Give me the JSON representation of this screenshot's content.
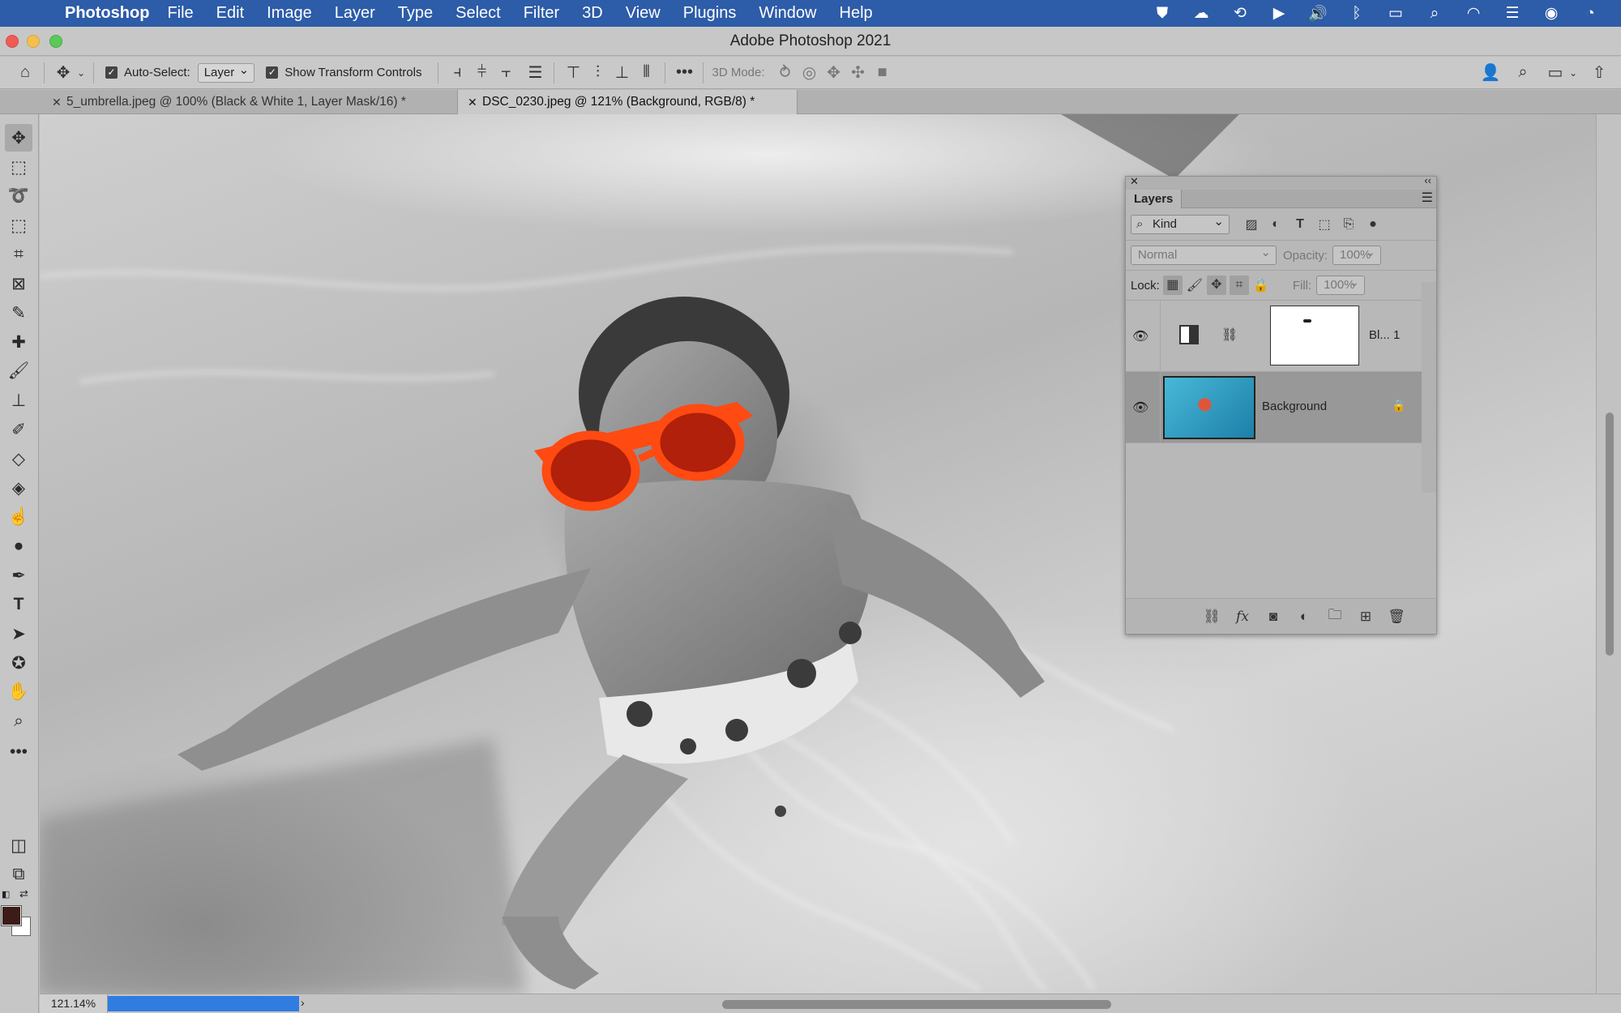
{
  "menubar": {
    "app_name": "Photoshop",
    "items": [
      "File",
      "Edit",
      "Image",
      "Layer",
      "Type",
      "Select",
      "Filter",
      "3D",
      "View",
      "Plugins",
      "Window",
      "Help"
    ]
  },
  "window": {
    "title": "Adobe Photoshop 2021"
  },
  "options": {
    "auto_select_label": "Auto-Select:",
    "auto_select_value": "Layer",
    "show_transform_label": "Show Transform Controls",
    "mode_3d_label": "3D Mode:"
  },
  "tabs": [
    {
      "label": "5_umbrella.jpeg @ 100% (Black & White 1, Layer Mask/16) *",
      "active": false
    },
    {
      "label": "DSC_0230.jpeg @ 121% (Background, RGB/8) *",
      "active": true
    }
  ],
  "status": {
    "zoom": "121.14%"
  },
  "layers_panel": {
    "title": "Layers",
    "filter_kind": "Kind",
    "blend_mode": "Normal",
    "opacity_label": "Opacity:",
    "opacity_value": "100%",
    "lock_label": "Lock:",
    "fill_label": "Fill:",
    "fill_value": "100%",
    "layers": [
      {
        "name": "Bl... 1"
      },
      {
        "name": "Background"
      }
    ]
  },
  "colors": {
    "accent": "#2d5ca8",
    "sunglasses": "#ff4a12",
    "foreground": "#3c1c17",
    "progress": "#2f7de0"
  }
}
